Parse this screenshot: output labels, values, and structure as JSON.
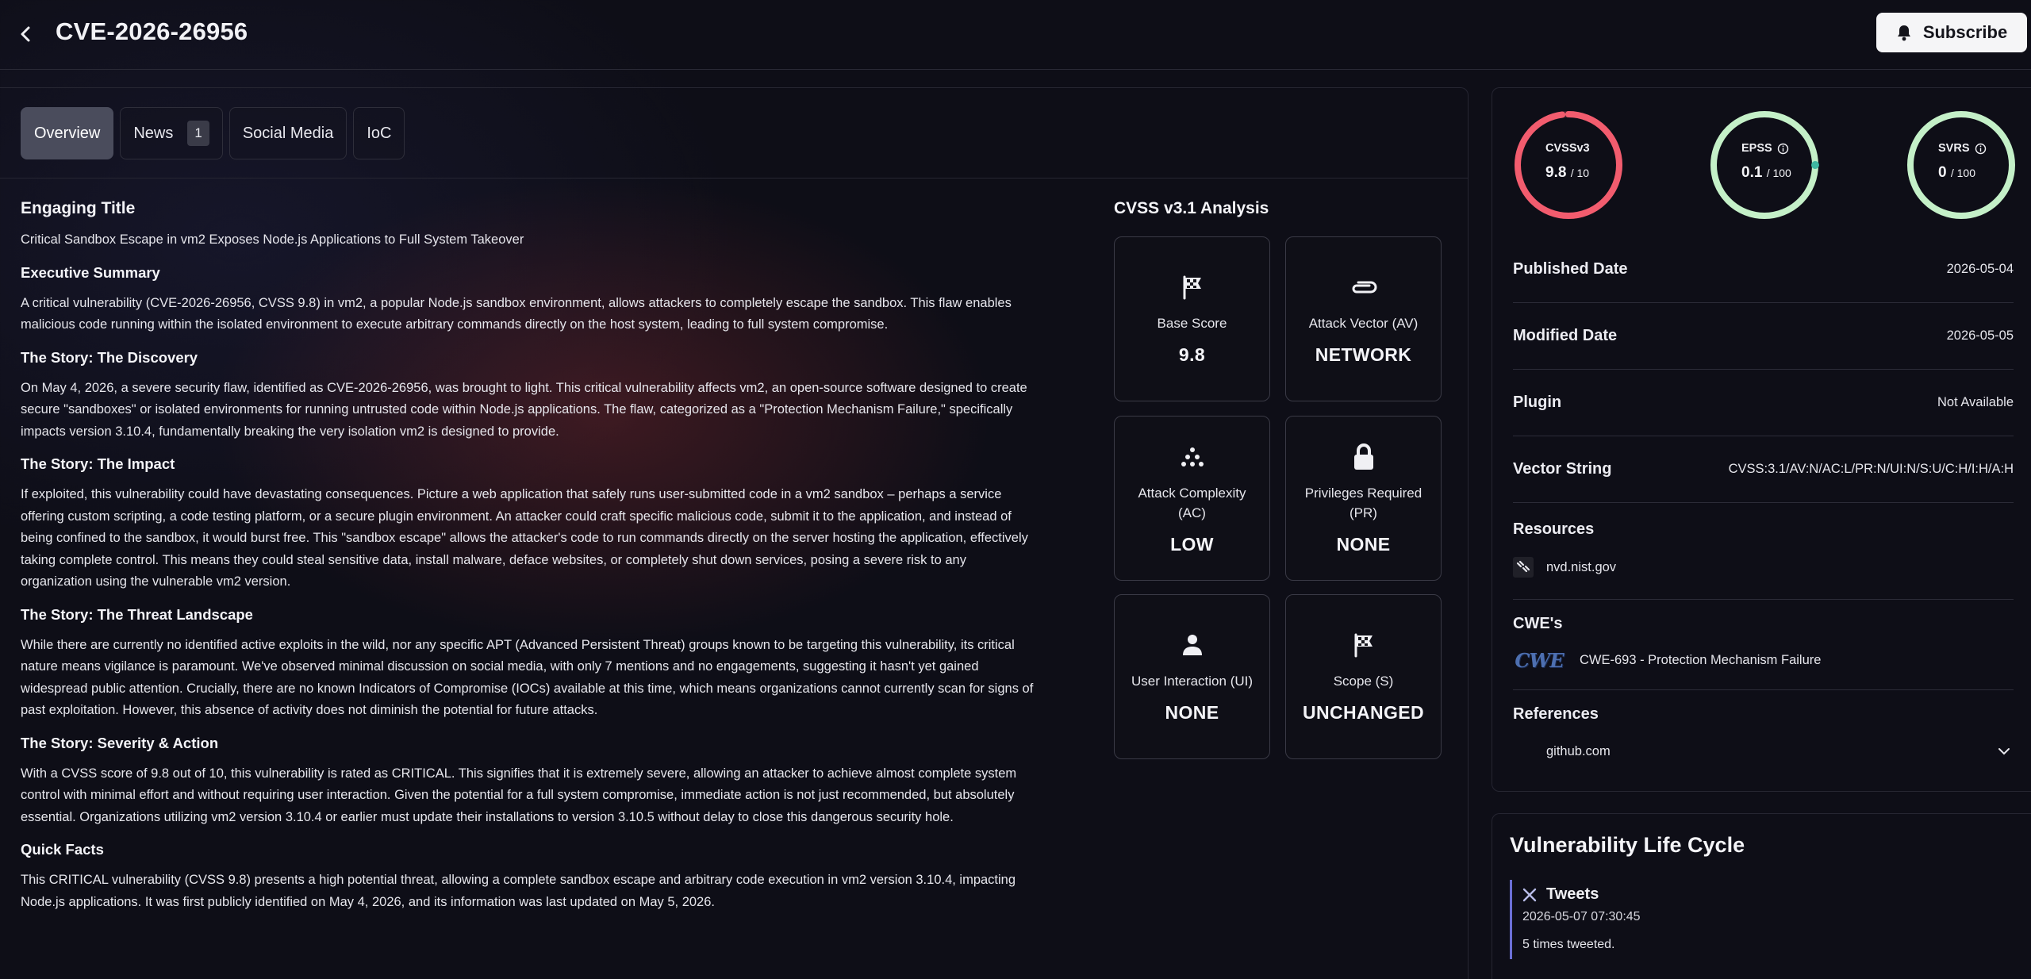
{
  "header": {
    "title": "CVE-2026-26956",
    "subscribe_label": "Subscribe"
  },
  "tabs": [
    {
      "label": "Overview",
      "badge": null
    },
    {
      "label": "News",
      "badge": "1"
    },
    {
      "label": "Social Media",
      "badge": null
    },
    {
      "label": "IoC",
      "badge": null
    }
  ],
  "article": {
    "engaging_title_heading": "Engaging Title",
    "engaging_title": "Critical Sandbox Escape in vm2 Exposes Node.js Applications to Full System Takeover",
    "sections": [
      {
        "heading": "Executive Summary",
        "lines": [
          "A critical vulnerability (CVE-2026-26956, CVSS 9.8) in vm2, a popular Node.js sandbox environment, allows attackers to completely escape the sandbox. This flaw enables",
          "malicious code running within the isolated environment to execute arbitrary commands directly on the host system, leading to full system compromise."
        ]
      },
      {
        "heading": "The Story: The Discovery",
        "lines": [
          "On May 4, 2026, a severe security flaw, identified as CVE-2026-26956, was brought to light. This critical vulnerability affects vm2, an open-source software designed to create",
          "secure \"sandboxes\" or isolated environments for running untrusted code within Node.js applications. The flaw, categorized as a \"Protection Mechanism Failure,\" specifically",
          "impacts version 3.10.4, fundamentally breaking the very isolation vm2 is designed to provide."
        ]
      },
      {
        "heading": "The Story: The Impact",
        "lines": [
          "If exploited, this vulnerability could have devastating consequences. Picture a web application that safely runs user-submitted code in a vm2 sandbox – perhaps a service",
          "offering custom scripting, a code testing platform, or a secure plugin environment. An attacker could craft specific malicious code, submit it to the application, and instead of",
          "being confined to the sandbox, it would burst free. This \"sandbox escape\" allows the attacker's code to run commands directly on the server hosting the application, effectively",
          "taking complete control. This means they could steal sensitive data, install malware, deface websites, or completely shut down services, posing a severe risk to any",
          "organization using the vulnerable vm2 version."
        ]
      },
      {
        "heading": "The Story: The Threat Landscape",
        "lines": [
          "While there are currently no identified active exploits in the wild, nor any specific APT (Advanced Persistent Threat) groups known to be targeting this vulnerability, its critical",
          "nature means vigilance is paramount. We've observed minimal discussion on social media, with only 7 mentions and no engagements, suggesting it hasn't yet gained",
          "widespread public attention. Crucially, there are no known Indicators of Compromise (IOCs) available at this time, which means organizations cannot currently scan for signs of",
          "past exploitation. However, this absence of activity does not diminish the potential for future attacks."
        ]
      },
      {
        "heading": "The Story: Severity & Action",
        "lines": [
          "With a CVSS score of 9.8 out of 10, this vulnerability is rated as CRITICAL. This signifies that it is extremely severe, allowing an attacker to achieve almost complete system",
          "control with minimal effort and without requiring user interaction. Given the potential for a full system compromise, immediate action is not just recommended, but absolutely",
          "essential. Organizations utilizing vm2 version 3.10.4 or earlier must update their installations to version 3.10.5 without delay to close this dangerous security hole."
        ]
      },
      {
        "heading": "Quick Facts",
        "lines": [
          "This CRITICAL vulnerability (CVSS 9.8) presents a high potential threat, allowing a complete sandbox escape and arbitrary code execution in vm2 version 3.10.4, impacting",
          "Node.js applications. It was first publicly identified on May 4, 2026, and its information was last updated on May 5, 2026."
        ]
      }
    ]
  },
  "cvss": {
    "title": "CVSS v3.1 Analysis",
    "cards": [
      {
        "label": "Base Score",
        "value": "9.8",
        "icon": "flag-icon"
      },
      {
        "label": "Attack Vector (AV)",
        "value": "NETWORK",
        "icon": "paperclip-icon"
      },
      {
        "label": "Attack Complexity (AC)",
        "value": "LOW",
        "icon": "dots-pyramid-icon"
      },
      {
        "label": "Privileges Required (PR)",
        "value": "NONE",
        "icon": "lock-icon"
      },
      {
        "label": "User Interaction (UI)",
        "value": "NONE",
        "icon": "user-icon"
      },
      {
        "label": "Scope (S)",
        "value": "UNCHANGED",
        "icon": "flag-icon"
      }
    ]
  },
  "scores": [
    {
      "name": "CVSSv3",
      "value": "9.8",
      "max": "/ 10",
      "fraction": 0.98,
      "color": "#f25c6e",
      "info": false
    },
    {
      "name": "EPSS",
      "value": "0.1",
      "max": "/ 100",
      "fraction": 0.001,
      "color": "#c4f0c8",
      "info": true
    },
    {
      "name": "SVRS",
      "value": "0",
      "max": "/ 100",
      "fraction": 0,
      "color": "#c4f0c8",
      "info": true
    }
  ],
  "details": {
    "published_label": "Published Date",
    "published_value": "2026-05-04",
    "modified_label": "Modified Date",
    "modified_value": "2026-05-05",
    "plugin_label": "Plugin",
    "plugin_value": "Not Available",
    "vector_label": "Vector String",
    "vector_value": "CVSS:3.1/AV:N/AC:L/PR:N/UI:N/S:U/C:H/I:H/A:H",
    "resources_label": "Resources",
    "resource_link": "nvd.nist.gov",
    "cwe_label": "CWE's",
    "cwe_logo_text": "CWE",
    "cwe_item": "CWE-693 - Protection Mechanism Failure",
    "references_label": "References",
    "reference_link": "github.com"
  },
  "lifecycle": {
    "title": "Vulnerability Life Cycle",
    "event_title": "Tweets",
    "event_time": "2026-05-07 07:30:45",
    "event_desc": "5 times tweeted."
  },
  "colors": {
    "accent": "#6b6fd6",
    "critical": "#f25c6e",
    "low": "#c4f0c8"
  }
}
